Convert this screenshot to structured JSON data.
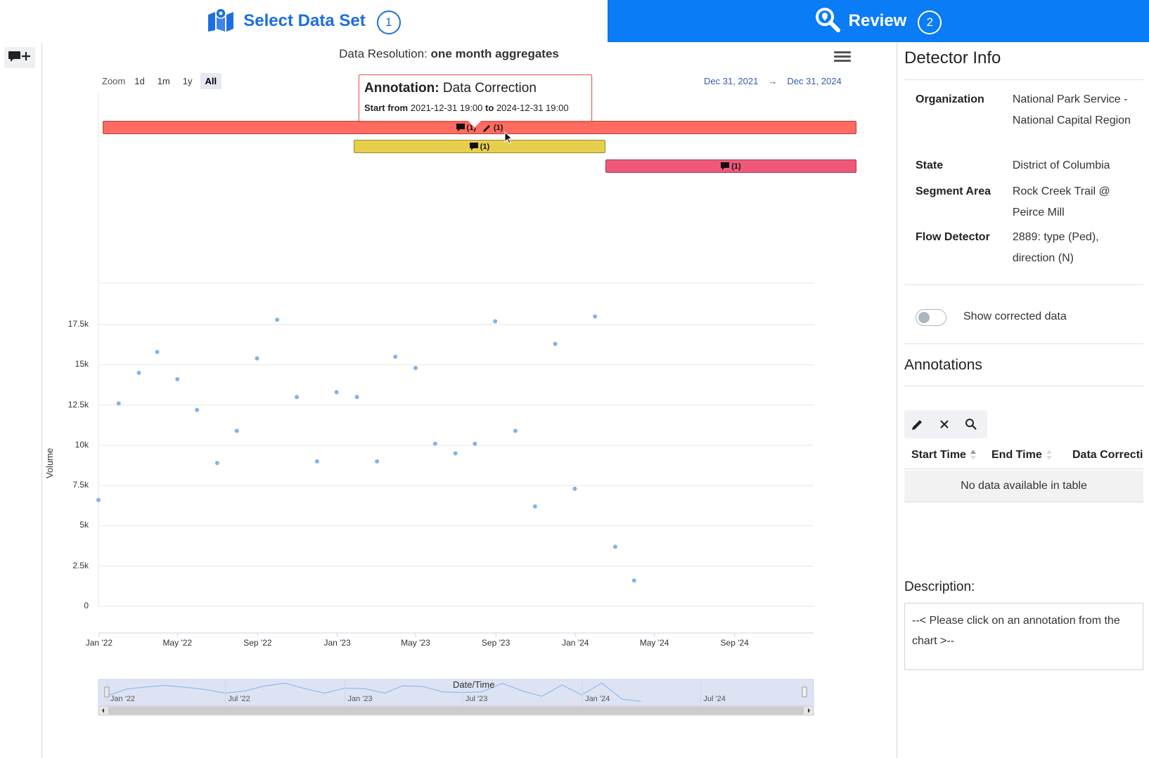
{
  "steps": [
    {
      "label": "Select Data Set",
      "number": "1",
      "icon": "map-marker-icon",
      "active": false
    },
    {
      "label": "Review",
      "number": "2",
      "icon": "search-location-icon",
      "active": true
    }
  ],
  "toolbar": {
    "add_annotation_icon": "comment-plus-icon"
  },
  "chart": {
    "title_prefix": "Data Resolution:",
    "title_value": "one month aggregates",
    "menu_icon": "hamburger-menu-icon",
    "zoom": {
      "label": "Zoom",
      "buttons": [
        "1d",
        "1m",
        "1y",
        "All"
      ],
      "active": "All"
    },
    "range": {
      "from": "Dec 31, 2021",
      "arrow": "→",
      "to": "Dec 31, 2024"
    },
    "tooltip": {
      "title_bold": "Annotation:",
      "title": "Data Correction",
      "start_bold": "Start from",
      "start": "2021-12-31 19:00",
      "to_bold": "to",
      "end": "2024-12-31 19:00"
    },
    "annotation_bars": [
      {
        "color": "#ff6b61",
        "chips": [
          "(1)",
          "(1)"
        ],
        "chip_icons": [
          "comment-icon",
          "pencil-icon"
        ]
      },
      {
        "color": "#e6cf4c",
        "chips": [
          "(1)"
        ],
        "chip_icons": [
          "comment-icon"
        ]
      },
      {
        "color": "#f0587a",
        "chips": [
          "(1)"
        ],
        "chip_icons": [
          "comment-icon"
        ]
      }
    ],
    "y_ticks": [
      "17.5k",
      "15k",
      "12.5k",
      "10k",
      "7.5k",
      "5k",
      "2.5k",
      "0"
    ],
    "x_ticks": [
      "Jan '22",
      "May '22",
      "Sep '22",
      "Jan '23",
      "May '23",
      "Sep '23",
      "Jan '24",
      "May '24",
      "Sep '24"
    ],
    "navigator_ticks": [
      "Jan '22",
      "Jul '22",
      "Jan '23",
      "Jul '23",
      "Jan '24",
      "Jul '24"
    ],
    "ylabel": "Volume",
    "xlabel": "Date/Time",
    "point_color": "#7cb5ec"
  },
  "chart_data": {
    "type": "scatter",
    "title": "Data Resolution: one month aggregates",
    "xlabel": "Date/Time",
    "ylabel": "Volume",
    "ylim": [
      0,
      17500
    ],
    "xlim": [
      "2021-12-31",
      "2024-12-31"
    ],
    "grid": true,
    "series": [
      {
        "x": [
          "2021-12",
          "2022-01",
          "2022-02",
          "2022-03",
          "2022-04",
          "2022-05",
          "2022-06",
          "2022-07",
          "2022-08",
          "2022-09",
          "2022-10",
          "2022-11",
          "2022-12",
          "2023-01",
          "2023-02",
          "2023-03",
          "2023-04",
          "2023-05",
          "2023-06",
          "2023-07",
          "2023-08",
          "2023-09",
          "2023-10",
          "2023-11",
          "2023-12",
          "2024-01",
          "2024-02",
          "2024-03",
          "2024-04"
        ],
        "y": [
          6600,
          12600,
          14500,
          15800,
          14100,
          12200,
          8900,
          10900,
          15400,
          17800,
          13000,
          9000,
          13300,
          13000,
          9000,
          15500,
          14800,
          10100,
          9500,
          10100,
          17700,
          10900,
          6200,
          16300,
          7300,
          18000,
          3700,
          1600,
          null
        ]
      }
    ]
  },
  "detector_info": {
    "heading": "Detector Info",
    "rows": [
      {
        "key": "Organization",
        "value": "National Park Service - National Capital Region"
      },
      {
        "key": "State",
        "value": "District of Columbia"
      },
      {
        "key": "Segment Area",
        "value": "Rock Creek Trail @ Peirce Mill"
      },
      {
        "key": "Flow Detector",
        "value": "2889: type (Ped), direction (N)"
      }
    ],
    "toggle_label": "Show corrected data",
    "toggle_on": false
  },
  "annotations": {
    "heading": "Annotations",
    "tool_icons": [
      "pencil-icon",
      "close-icon",
      "search-icon"
    ],
    "columns": [
      "Start Time",
      "End Time",
      "Data Correcti"
    ],
    "empty_text": "No data available in table",
    "description_label": "Description:",
    "description_text": "--< Please click on an annotation from the chart >--"
  }
}
